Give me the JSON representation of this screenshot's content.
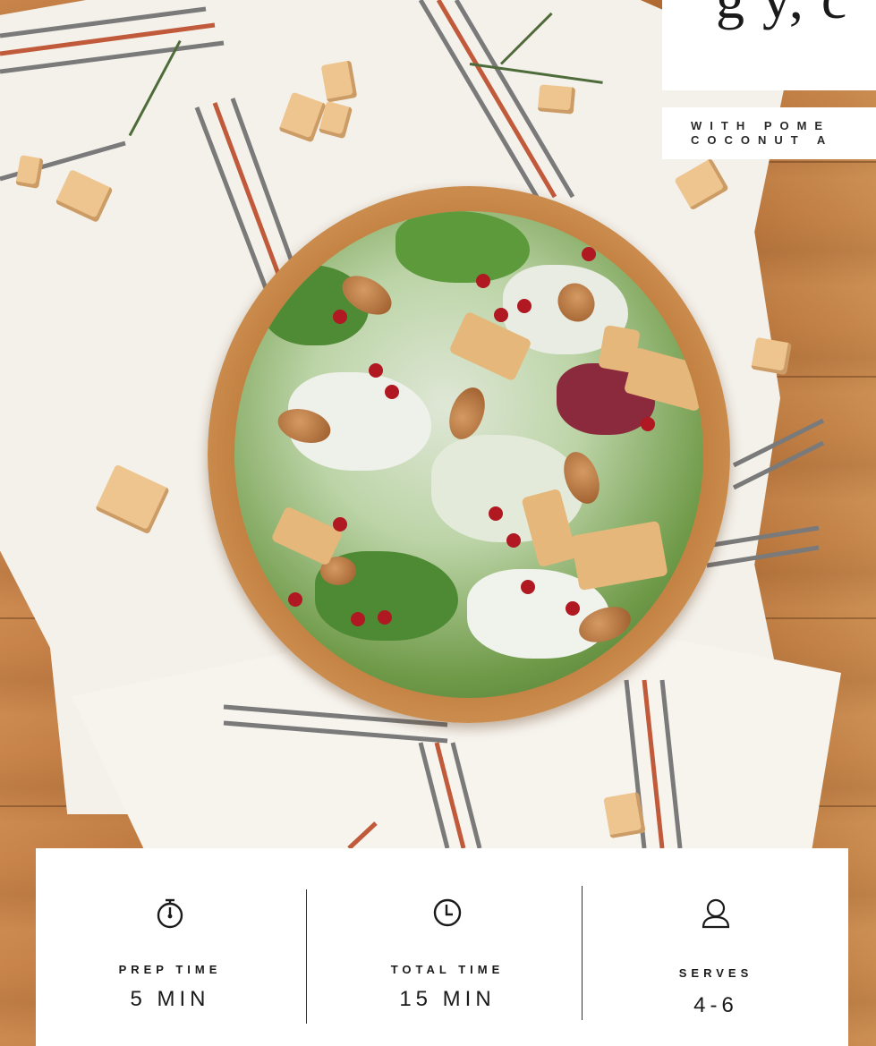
{
  "title_card": {
    "title_fragment": "g y, c"
  },
  "subtitle": {
    "line1": "WITH POME",
    "line2": "COCONUT A"
  },
  "info": {
    "prep": {
      "icon": "stopwatch-icon",
      "label": "PREP TIME",
      "value": "5 MIN"
    },
    "total": {
      "icon": "clock-icon",
      "label": "TOTAL TIME",
      "value": "15 MIN"
    },
    "serves": {
      "icon": "person-icon",
      "label": "SERVES",
      "value": "4-6"
    }
  },
  "colors": {
    "wood": "#c07e3e",
    "towel": "#f4f1ea",
    "card": "#ffffff",
    "text": "#1a1a1a"
  }
}
